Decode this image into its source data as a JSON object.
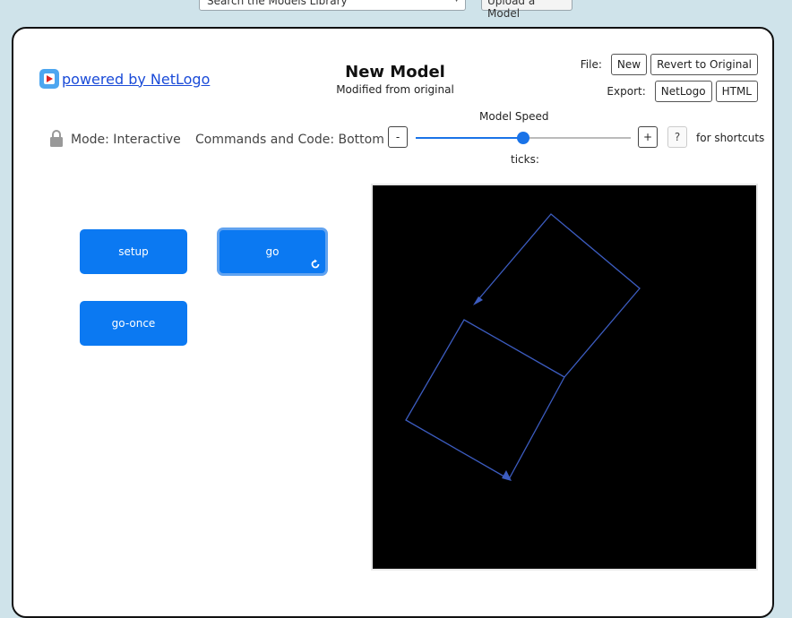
{
  "top_bar": {
    "models_search_placeholder": "Search the Models Library",
    "upload_label": "Upload a Model"
  },
  "brand": {
    "link_text": "powered by NetLogo"
  },
  "model": {
    "title": "New Model",
    "subtitle": "Modified from original"
  },
  "file": {
    "label": "File:",
    "new_label": "New",
    "revert_label": "Revert to Original"
  },
  "export": {
    "label": "Export:",
    "netlogo_label": "NetLogo",
    "html_label": "HTML"
  },
  "mode": {
    "label": "Mode: Interactive",
    "commands_label": "Commands and Code: Bottom"
  },
  "speed": {
    "label": "Model Speed",
    "minus_label": "-",
    "plus_label": "+",
    "value_fraction": 0.5,
    "help_label": "?",
    "shortcuts_label": "for shortcuts",
    "ticks_label": "ticks:"
  },
  "buttons": {
    "setup": "setup",
    "go": "go",
    "go_once": "go-once"
  },
  "colors": {
    "accent": "#0b79f2",
    "turtle_line": "#3c5cc0",
    "view_bg": "#000000"
  }
}
